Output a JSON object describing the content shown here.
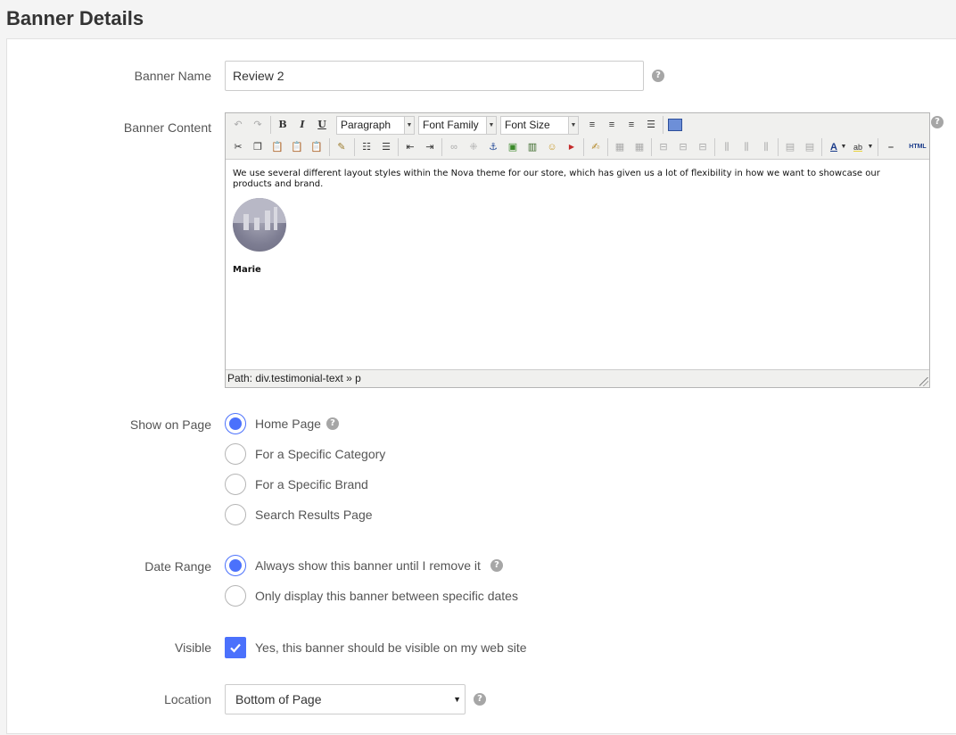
{
  "page": {
    "title": "Banner Details"
  },
  "form": {
    "banner_name": {
      "label": "Banner Name",
      "value": "Review 2"
    },
    "banner_content": {
      "label": "Banner Content",
      "toolbar": {
        "bold": "B",
        "italic": "I",
        "underline": "U",
        "format_select": "Paragraph",
        "font_family_select": "Font Family",
        "font_size_select": "Font Size",
        "html_button": "HTML"
      },
      "body_text": "We use several different layout styles within the Nova theme for our store, which has given us a lot of flexibility in how we want to showcase our products and brand.",
      "author": "Marie",
      "path": "Path: div.testimonial-text » p"
    },
    "show_on_page": {
      "label": "Show on Page",
      "options": [
        {
          "label": "Home Page",
          "selected": true
        },
        {
          "label": "For a Specific Category",
          "selected": false
        },
        {
          "label": "For a Specific Brand",
          "selected": false
        },
        {
          "label": "Search Results Page",
          "selected": false
        }
      ]
    },
    "date_range": {
      "label": "Date Range",
      "options": [
        {
          "label": "Always show this banner until I remove it",
          "selected": true
        },
        {
          "label": "Only display this banner between specific dates",
          "selected": false
        }
      ]
    },
    "visible": {
      "label": "Visible",
      "checkbox_label": "Yes, this banner should be visible on my web site",
      "checked": true
    },
    "location": {
      "label": "Location",
      "value": "Bottom of Page"
    }
  },
  "help_glyph": "?",
  "colors": {
    "accent": "#4b71fc",
    "help": "#a6a6a6"
  }
}
